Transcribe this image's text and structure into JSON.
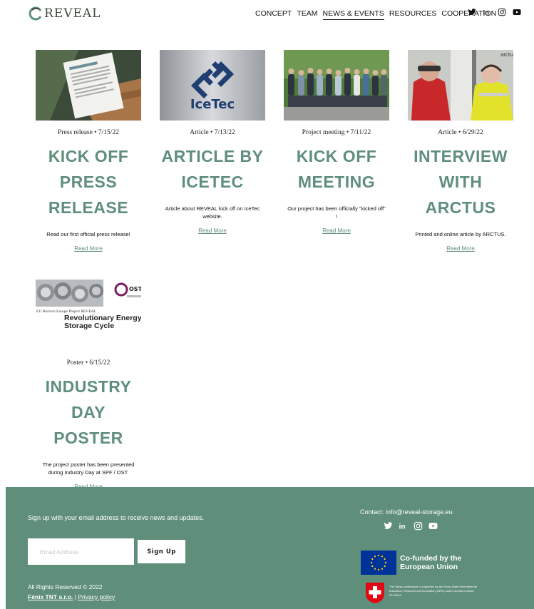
{
  "brand": {
    "name": "REVEAL"
  },
  "nav": {
    "items": [
      "CONCEPT",
      "TEAM",
      "NEWS & EVENTS",
      "RESOURCES",
      "COOPERATION"
    ],
    "active": "NEWS & EVENTS"
  },
  "social_icons": [
    "twitter-icon",
    "linkedin-icon",
    "instagram-icon",
    "youtube-icon"
  ],
  "posts": [
    {
      "meta": "Press release • 7/15/22",
      "title": "KICK OFF PRESS RELEASE",
      "description": "Read our first official press release!",
      "read_more": "Read More"
    },
    {
      "meta": "Article • 7/13/22",
      "title": "ARTICLE BY ICETEC",
      "description": "Article about REVEAL kick off on IceTec website.",
      "read_more": "Read More",
      "image_text": "IceTec"
    },
    {
      "meta": "Project meeting • 7/11/22",
      "title": "KICK OFF MEETING",
      "description": "Our project has been officially \"kicked off\" !",
      "read_more": "Read More"
    },
    {
      "meta": "Article • 6/29/22",
      "title": "INTERVIEW WITH ARCTUS",
      "description": "Printed and online article by ARCTUS.",
      "read_more": "Read More",
      "image_text": "arctu"
    },
    {
      "meta": "Poster • 6/15/22",
      "title": "INDUSTRY DAY POSTER",
      "description": "The project poster has been presented during Industry Day at SPF / OST.",
      "read_more": "Read More",
      "image_text": {
        "logo": "OST",
        "project_line": "EU Horizon Europe Project REVEAL",
        "headline": "Revolutionary Energy Storage Cycle"
      }
    }
  ],
  "footer": {
    "signup_text": "Sign up with your email address to receive news and updates.",
    "email_placeholder": "Email Address",
    "signup_button": "Sign Up",
    "rights": "All Rights Reserved © 2022",
    "company_link": "Fénix TNT s.r.o.",
    "separator": "|",
    "privacy_link": "Privacy policy",
    "contact": "Contact: info@reveal-storage.eu",
    "eu_text": "Co-funded by the European Union",
    "swiss_text": "The Swiss contribution is supported by the Swiss State Secretariat for Education, Research and Innovation (SERI) under contract number 22.00043",
    "colors": {
      "background": "#5f8e7b"
    }
  },
  "colors": {
    "accent": "#5f8f7c"
  }
}
